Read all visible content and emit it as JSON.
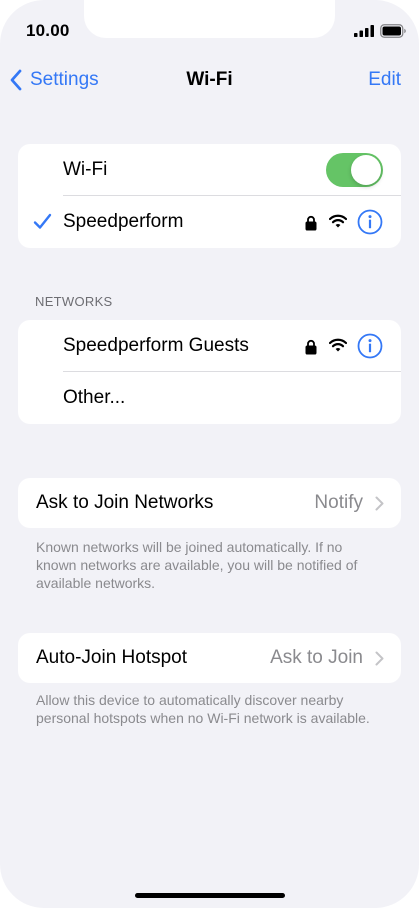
{
  "status_bar": {
    "time": "10.00"
  },
  "nav": {
    "back_label": "Settings",
    "title": "Wi-Fi",
    "edit_label": "Edit"
  },
  "wifi_group": {
    "toggle_label": "Wi-Fi",
    "toggle_on": true,
    "connected_network": "Speedperform"
  },
  "networks": {
    "header": "NETWORKS",
    "items": [
      {
        "name": "Speedperform Guests"
      }
    ],
    "other_label": "Other..."
  },
  "ask_to_join": {
    "label": "Ask to Join Networks",
    "value": "Notify",
    "footer": "Known networks will be joined automatically. If no known networks are available, you will be notified of available networks."
  },
  "auto_join": {
    "label": "Auto-Join Hotspot",
    "value": "Ask to Join",
    "footer": "Allow this device to automatically discover nearby personal hotspots when no Wi-Fi network is available."
  },
  "colors": {
    "accent": "#3478f6",
    "toggle_on": "#65c466",
    "background": "#f2f2f7",
    "secondary_text": "#8a8a8e"
  },
  "icons": [
    "signal-icon",
    "battery-icon",
    "chevron-left-icon",
    "checkmark-icon",
    "lock-icon",
    "wifi-icon",
    "info-icon",
    "chevron-right-icon"
  ]
}
